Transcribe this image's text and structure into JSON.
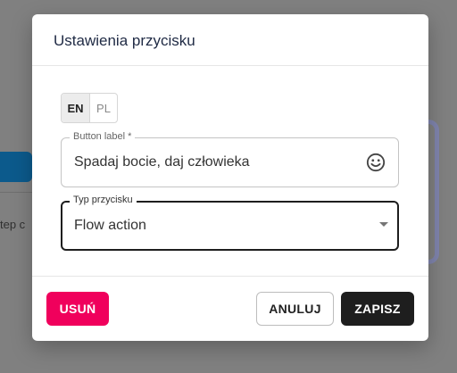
{
  "background": {
    "partial_text": "tep  c"
  },
  "dialog": {
    "title": "Ustawienia przycisku",
    "language_toggle": {
      "options": [
        {
          "label": "EN",
          "selected": true
        },
        {
          "label": "PL",
          "selected": false
        }
      ]
    },
    "button_label_field": {
      "label": "Button label *",
      "value": "Spadaj bocie, daj człowieka",
      "icon": "emoji-smile-icon"
    },
    "button_type_field": {
      "label": "Typ przycisku",
      "value": "Flow action",
      "icon": "dropdown-arrow-icon"
    },
    "actions": {
      "delete_label": "USUŃ",
      "cancel_label": "ANULUJ",
      "save_label": "ZAPISZ"
    }
  },
  "colors": {
    "delete": "#f0005c",
    "save": "#1e1e1e",
    "overlay": "#808080"
  }
}
